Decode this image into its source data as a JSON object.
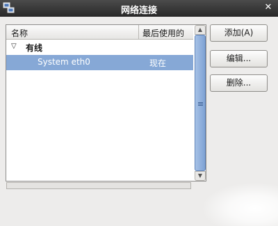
{
  "window": {
    "title": "网络连接",
    "close_symbol": "✕",
    "app_icon": "network-icon"
  },
  "list": {
    "columns": [
      "名称",
      "最后使用的"
    ],
    "groups": [
      {
        "label": "有线",
        "expanded": true,
        "connections": [
          {
            "name": "System eth0",
            "last_used": "现在",
            "selected": true
          }
        ]
      }
    ]
  },
  "buttons": {
    "add": "添加(A)",
    "edit": "编辑...",
    "delete": "删除..."
  },
  "colors": {
    "selection": "#86a8d6",
    "scroll_thumb": "#7ea2d4",
    "titlebar": "#2a2a2a"
  }
}
